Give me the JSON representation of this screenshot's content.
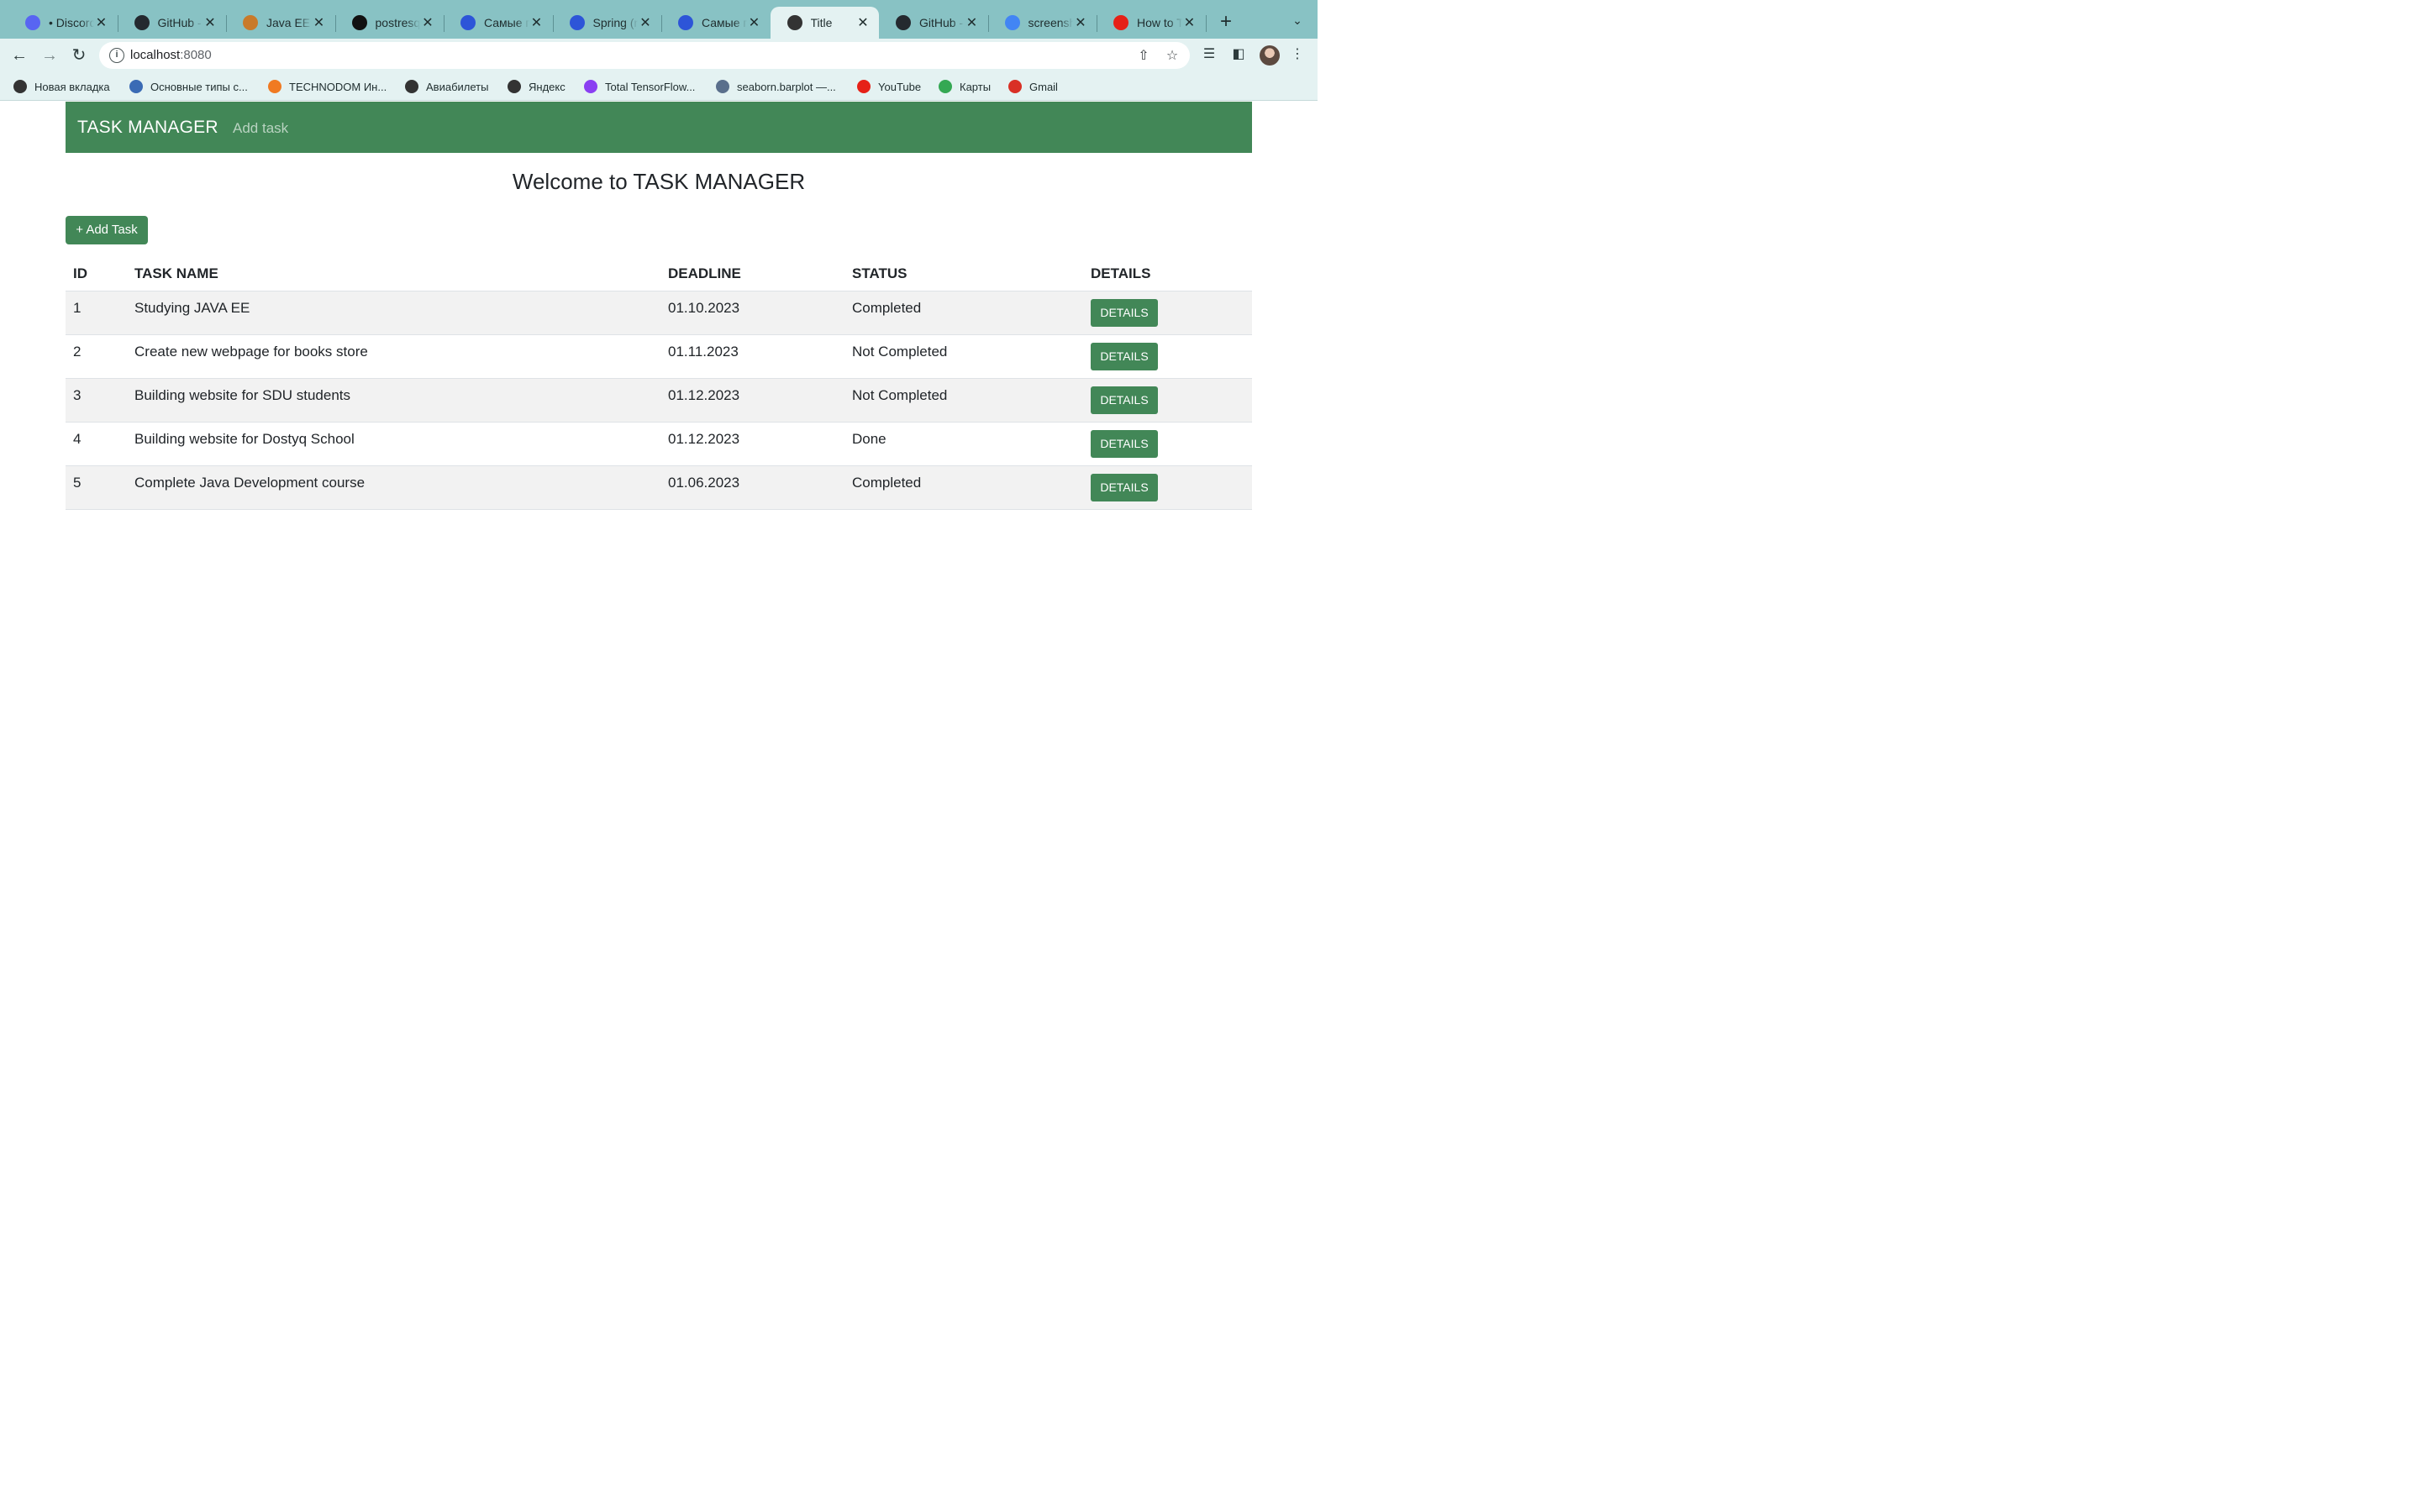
{
  "browser": {
    "tabs": [
      {
        "title": "• Discord",
        "icon": "discord-icon",
        "color": "#5865f2",
        "active": false
      },
      {
        "title": "GitHub - ",
        "icon": "github-icon",
        "color": "#24292f",
        "active": false
      },
      {
        "title": "Java EE [",
        "icon": "java-icon",
        "color": "#c97a2a",
        "active": false
      },
      {
        "title": "postresql",
        "icon": "chatgpt-icon",
        "color": "#111111",
        "active": false
      },
      {
        "title": "Самые по",
        "icon": "c-icon",
        "color": "#2d55d8",
        "active": false
      },
      {
        "title": "Spring (n",
        "icon": "c-icon",
        "color": "#2d55d8",
        "active": false
      },
      {
        "title": "Самые по",
        "icon": "c-icon",
        "color": "#2d55d8",
        "active": false
      },
      {
        "title": "Title",
        "icon": "globe-icon",
        "color": "#333333",
        "active": true
      },
      {
        "title": "GitHub - ",
        "icon": "github-icon",
        "color": "#24292f",
        "active": false
      },
      {
        "title": "screensh",
        "icon": "google-icon",
        "color": "#4285f4",
        "active": false
      },
      {
        "title": "How to Ta",
        "icon": "youtube-icon",
        "color": "#e62117",
        "active": false
      }
    ],
    "url": {
      "host": "localhost",
      "port": ":8080"
    },
    "bookmarks": [
      {
        "label": "Новая вкладка",
        "icon": "globe-icon",
        "color": "#333333"
      },
      {
        "label": "Основные типы с...",
        "icon": "bank-icon",
        "color": "#3a6bb5"
      },
      {
        "label": "TECHNODOM Ин...",
        "icon": "technodom-icon",
        "color": "#f07a22"
      },
      {
        "label": "Авиабилеты",
        "icon": "globe-icon",
        "color": "#333333"
      },
      {
        "label": "Яндекс",
        "icon": "globe-icon",
        "color": "#333333"
      },
      {
        "label": "Total TensorFlow...",
        "icon": "tensorflow-icon",
        "color": "#8a3ff2"
      },
      {
        "label": "seaborn.barplot —...",
        "icon": "seaborn-icon",
        "color": "#5a6f8c"
      },
      {
        "label": "YouTube",
        "icon": "youtube-icon",
        "color": "#e62117"
      },
      {
        "label": "Карты",
        "icon": "maps-icon",
        "color": "#34a853"
      },
      {
        "label": "Gmail",
        "icon": "gmail-icon",
        "color": "#d93025"
      }
    ]
  },
  "navbar": {
    "brand": "TASK MANAGER",
    "add_link": "Add task"
  },
  "main": {
    "welcome": "Welcome to TASK MANAGER",
    "add_button": "+ Add Task"
  },
  "table": {
    "headers": [
      "ID",
      "TASK NAME",
      "DEADLINE",
      "STATUS",
      "DETAILS"
    ],
    "rows": [
      {
        "id": "1",
        "name": "Studying JAVA EE",
        "deadline": "01.10.2023",
        "status": "Completed",
        "details": "DETAILS"
      },
      {
        "id": "2",
        "name": "Create new webpage for books store",
        "deadline": "01.11.2023",
        "status": "Not Completed",
        "details": "DETAILS"
      },
      {
        "id": "3",
        "name": "Building website for SDU students",
        "deadline": "01.12.2023",
        "status": "Not Completed",
        "details": "DETAILS"
      },
      {
        "id": "4",
        "name": "Building website for Dostyq School",
        "deadline": "01.12.2023",
        "status": "Done",
        "details": "DETAILS"
      },
      {
        "id": "5",
        "name": "Complete Java Development course",
        "deadline": "01.06.2023",
        "status": "Completed",
        "details": "DETAILS"
      }
    ]
  },
  "colors": {
    "accent": "#428757",
    "tabstrip": "#88c2c4",
    "toolbar": "#e4f2f2"
  }
}
